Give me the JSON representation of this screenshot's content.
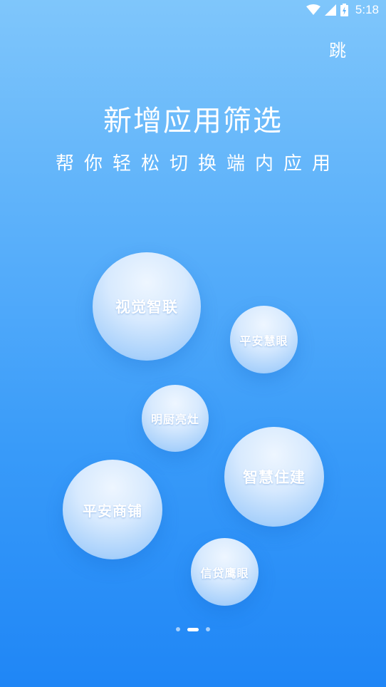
{
  "status_bar": {
    "time": "5:18",
    "icons": [
      "wifi-icon",
      "cell-signal-icon",
      "battery-charging-icon"
    ]
  },
  "header": {
    "skip_label": "跳"
  },
  "hero": {
    "title": "新增应用筛选",
    "subtitle": "帮你轻松切换端内应用"
  },
  "apps": [
    {
      "label": "视觉智联"
    },
    {
      "label": "平安慧眼"
    },
    {
      "label": "明厨亮灶"
    },
    {
      "label": "智慧住建"
    },
    {
      "label": "平安商铺"
    },
    {
      "label": "信贷鹰眼"
    }
  ],
  "pager": {
    "total": 3,
    "current": 2
  },
  "colors": {
    "background_top": "#7fc6fb",
    "background_bottom": "#1f86f6",
    "text": "#ffffff"
  }
}
